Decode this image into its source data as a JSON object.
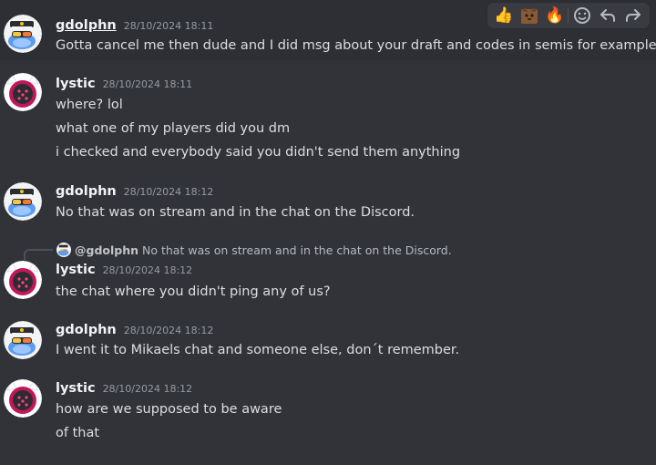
{
  "toolbar": {
    "reactions": [
      {
        "icon": "thumbs-up-icon",
        "glyph": "👍"
      },
      {
        "icon": "cat-face-icon",
        "glyph": "😾"
      },
      {
        "icon": "fire-icon",
        "glyph": "🔥"
      }
    ],
    "actions": [
      {
        "icon": "add-reaction-icon"
      },
      {
        "icon": "reply-icon"
      },
      {
        "icon": "forward-icon"
      }
    ]
  },
  "messages": [
    {
      "author": "gdolphn",
      "timestamp": "28/10/2024 18:11",
      "lines": [
        "Gotta cancel me then dude and I did msg about your draft and codes in semis for example."
      ]
    },
    {
      "author": "lystic",
      "timestamp": "28/10/2024 18:11",
      "lines": [
        "where? lol",
        "what one of my players did you dm",
        "i checked and everybody said you didn't send them anything"
      ]
    },
    {
      "author": "gdolphn",
      "timestamp": "28/10/2024 18:12",
      "lines": [
        "No that was on stream and in the chat on the Discord."
      ]
    },
    {
      "author": "lystic",
      "timestamp": "28/10/2024 18:12",
      "reply": {
        "mention": "@gdolphn",
        "text": "No that was on stream and in the chat on the Discord."
      },
      "lines": [
        "the chat where you didn't ping any of us?"
      ]
    },
    {
      "author": "gdolphn",
      "timestamp": "28/10/2024 18:12",
      "lines": [
        "I went it to Mikaels chat and someone else, don´t remember."
      ]
    },
    {
      "author": "lystic",
      "timestamp": "28/10/2024 18:12",
      "lines": [
        "how are we supposed to be aware",
        "of that"
      ]
    }
  ]
}
